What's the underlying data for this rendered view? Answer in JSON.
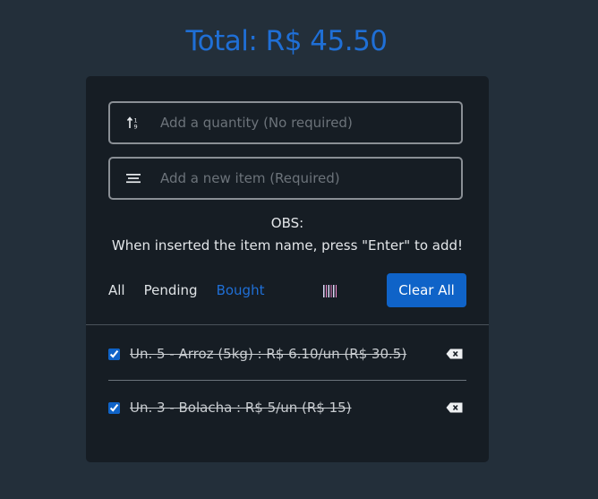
{
  "total": "Total: R$ 45.50",
  "quantity_field": {
    "placeholder": "Add a quantity (No required)",
    "icon": "sort-icon"
  },
  "item_field": {
    "placeholder": "Add a new item (Required)",
    "icon": "list-icon"
  },
  "obs": {
    "title": "OBS:",
    "text": "When inserted the item name, press \"Enter\" to add!"
  },
  "filters": {
    "all": "All",
    "pending": "Pending",
    "bought": "Bought",
    "active": "Bought"
  },
  "clear_all": "Clear All",
  "items": [
    {
      "text": "Un. 5 - Arroz (5kg) : R$ 6.10/un (R$ 30.5)",
      "checked": true
    },
    {
      "text": "Un. 3 - Bolacha : R$ 5/un (R$ 15)",
      "checked": true
    }
  ],
  "colors": {
    "accent": "#1f6fd6",
    "button": "#0f63c8",
    "background": "#232f3a",
    "card": "#161d24"
  }
}
